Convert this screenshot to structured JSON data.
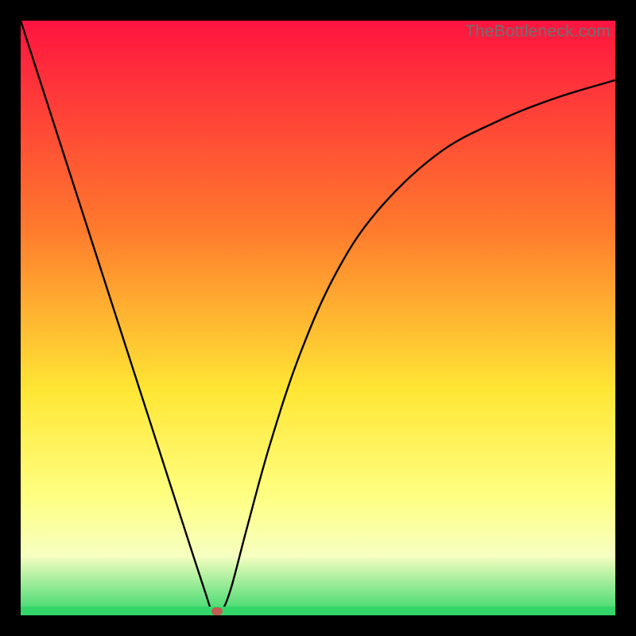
{
  "watermark": {
    "text": "TheBottleneck.com"
  },
  "colors": {
    "gradient_top": "#ff1440",
    "gradient_mid1": "#ff7a2d",
    "gradient_mid2": "#ffe634",
    "gradient_low1": "#ffff82",
    "gradient_low2": "#f6ffc0",
    "gradient_bottom": "#34d66a",
    "curve": "#000000",
    "marker": "#c25b52",
    "frame_bg": "#000000"
  },
  "chart_data": {
    "type": "line",
    "title": "",
    "xlabel": "",
    "ylabel": "",
    "xlim": [
      0,
      1
    ],
    "ylim": [
      0,
      1
    ],
    "gradient_stops": [
      {
        "offset": 0.0,
        "color": "#ff1440"
      },
      {
        "offset": 0.35,
        "color": "#ff7a2d"
      },
      {
        "offset": 0.62,
        "color": "#ffe634"
      },
      {
        "offset": 0.8,
        "color": "#ffff82"
      },
      {
        "offset": 0.9,
        "color": "#f6ffc0"
      },
      {
        "offset": 1.0,
        "color": "#34d66a"
      }
    ],
    "series": [
      {
        "name": "bottleneck-curve",
        "x": [
          0.0,
          0.05,
          0.1,
          0.15,
          0.2,
          0.25,
          0.29,
          0.31,
          0.322,
          0.33,
          0.34,
          0.355,
          0.38,
          0.42,
          0.47,
          0.53,
          0.6,
          0.7,
          0.8,
          0.9,
          1.0
        ],
        "y": [
          1.0,
          0.845,
          0.69,
          0.535,
          0.38,
          0.225,
          0.101,
          0.04,
          0.005,
          0.003,
          0.01,
          0.05,
          0.145,
          0.29,
          0.44,
          0.575,
          0.68,
          0.775,
          0.83,
          0.87,
          0.9
        ]
      }
    ],
    "marker": {
      "x": 0.33,
      "y": 0.0,
      "label": "optimal-point"
    }
  }
}
